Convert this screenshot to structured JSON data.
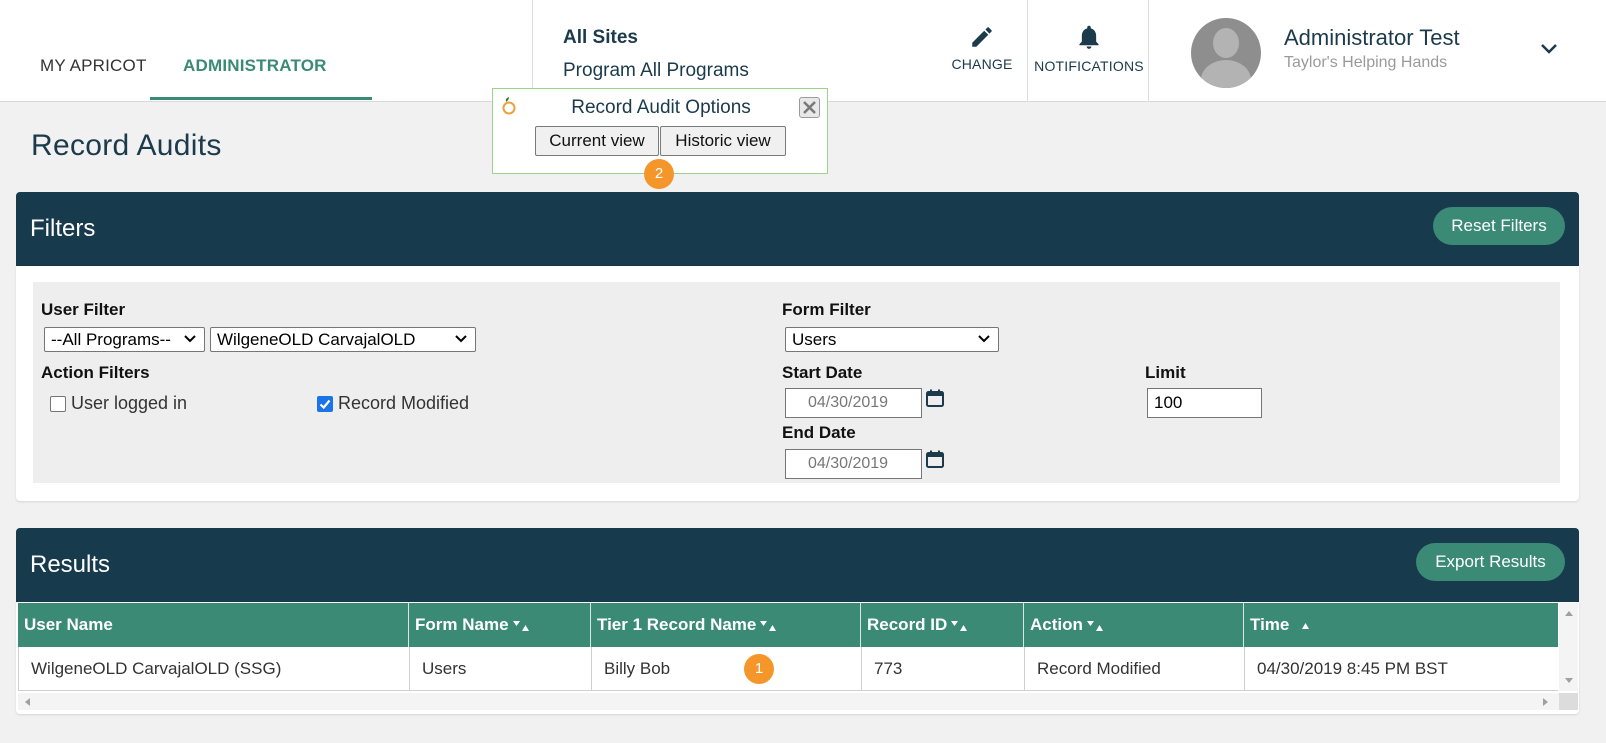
{
  "nav": {
    "my_apricot": "MY APRICOT",
    "administrator": "ADMINISTRATOR"
  },
  "site": {
    "name": "All Sites",
    "program": "Program All Programs"
  },
  "header_actions": {
    "change": "CHANGE",
    "notifications": "NOTIFICATIONS"
  },
  "user": {
    "name": "Administrator Test",
    "org": "Taylor's Helping Hands"
  },
  "popup": {
    "title": "Record Audit Options",
    "current_view": "Current view",
    "historic_view": "Historic view",
    "badge": "2"
  },
  "page_title": "Record Audits",
  "filters": {
    "title": "Filters",
    "reset": "Reset Filters",
    "user_filter_label": "User Filter",
    "program_select": "--All Programs--",
    "user_select": "WilgeneOLD CarvajalOLD",
    "action_filters_label": "Action Filters",
    "action_user_logged_in": "User logged in",
    "action_user_logged_in_checked": false,
    "action_record_modified": "Record Modified",
    "action_record_modified_checked": true,
    "form_filter_label": "Form Filter",
    "form_select": "Users",
    "start_date_label": "Start Date",
    "start_date": "04/30/2019",
    "end_date_label": "End Date",
    "end_date": "04/30/2019",
    "limit_label": "Limit",
    "limit": "100"
  },
  "results": {
    "title": "Results",
    "export": "Export Results",
    "columns": [
      "User Name",
      "Form Name",
      "Tier 1 Record Name",
      "Record ID",
      "Action",
      "Time"
    ],
    "rows": [
      [
        "WilgeneOLD CarvajalOLD (SSG)",
        "Users",
        "Billy Bob",
        "773",
        "Record Modified",
        "04/30/2019 8:45 PM BST"
      ]
    ],
    "badge": "1"
  },
  "colors": {
    "navy": "#173a4d",
    "teal": "#3a8a76",
    "badge_orange": "#f5962a"
  },
  "icons": [
    "pencil-icon",
    "bell-icon",
    "chevron-down-icon",
    "close-icon",
    "calendar-icon",
    "sort-icon",
    "apricot-logo-icon"
  ]
}
